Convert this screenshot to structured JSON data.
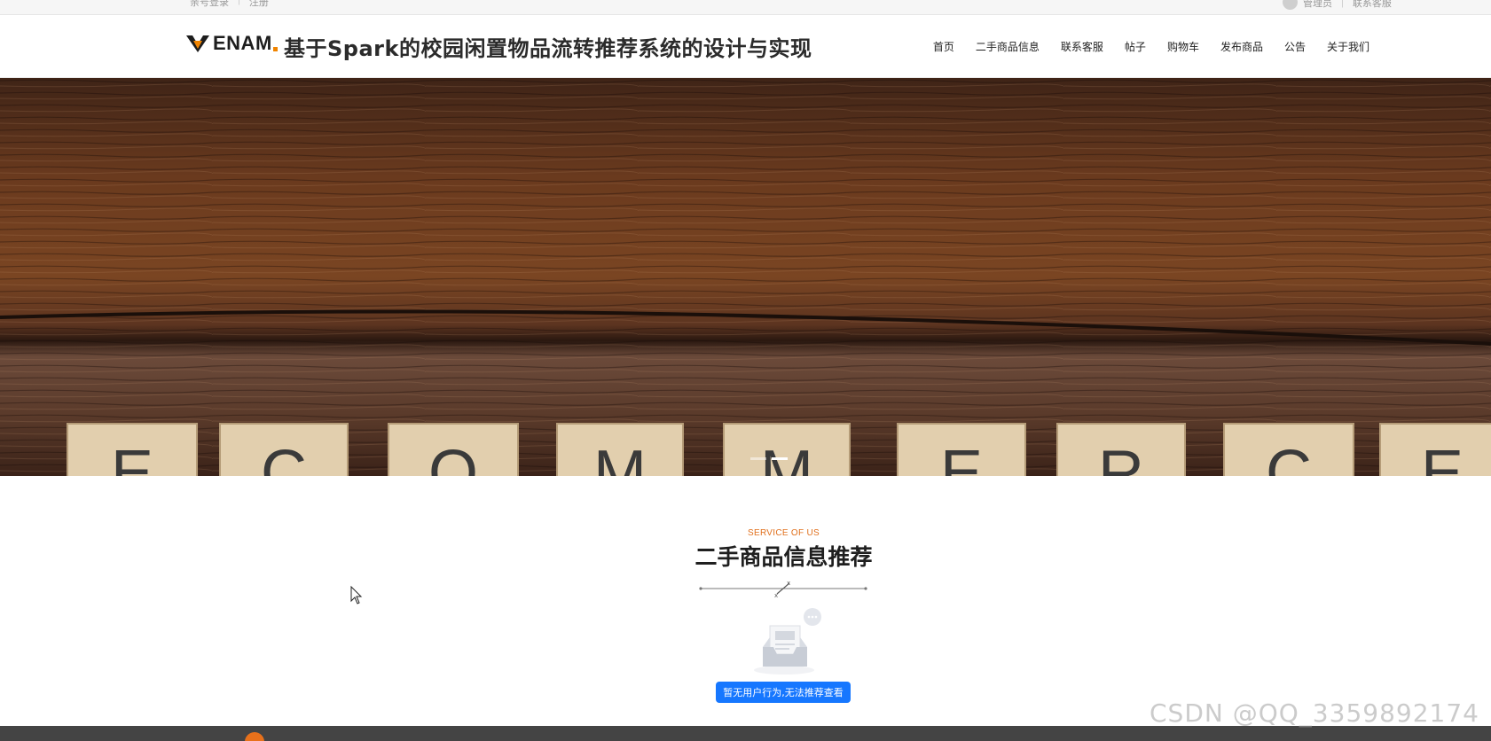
{
  "topbar": {
    "login": "亲号登录",
    "register": "注册",
    "user_login": "管理员",
    "help": "联系客服"
  },
  "header": {
    "logo_text": "ENAM",
    "site_title": "基于Spark的校园闲置物品流转推荐系统的设计与实现",
    "nav": [
      {
        "label": "首页"
      },
      {
        "label": "二手商品信息"
      },
      {
        "label": "联系客服"
      },
      {
        "label": "帖子"
      },
      {
        "label": "购物车"
      },
      {
        "label": "发布商品"
      },
      {
        "label": "公告"
      },
      {
        "label": "关于我们"
      }
    ]
  },
  "hero": {
    "tiles": [
      "E",
      "C",
      "O",
      "M",
      "M",
      "E",
      "R",
      "C",
      "E"
    ],
    "slides": 2,
    "active_slide": 1
  },
  "section": {
    "subtitle": "SERVICE OF US",
    "title": "二手商品信息推荐",
    "empty_button": "暂无用户行为,无法推荐查看"
  },
  "watermark": "CSDN @QQ_3359892174",
  "colors": {
    "accent": "#e0701d",
    "primary_button": "#1677ff",
    "footer": "#444444",
    "wood": "#5a3220"
  }
}
